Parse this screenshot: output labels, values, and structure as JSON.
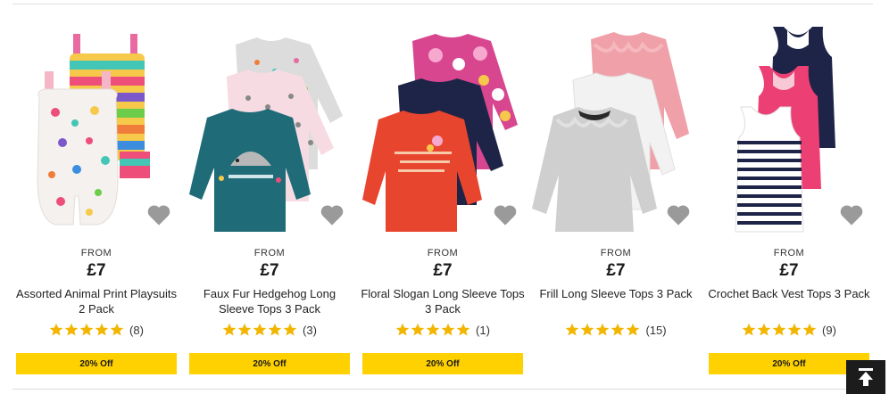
{
  "products": [
    {
      "from_label": "FROM",
      "price": "£7",
      "title": "Assorted Animal Print Playsuits 2 Pack",
      "review_count": "(8)",
      "promo": "20% Off",
      "image_icon": "playsuits-image"
    },
    {
      "from_label": "FROM",
      "price": "£7",
      "title": "Faux Fur Hedgehog Long Sleeve Tops 3 Pack",
      "review_count": "(3)",
      "promo": "20% Off",
      "image_icon": "hedgehog-tops-image"
    },
    {
      "from_label": "FROM",
      "price": "£7",
      "title": "Floral Slogan Long Sleeve Tops 3 Pack",
      "review_count": "(1)",
      "promo": "20% Off",
      "image_icon": "floral-tops-image"
    },
    {
      "from_label": "FROM",
      "price": "£7",
      "title": "Frill Long Sleeve Tops 3 Pack",
      "review_count": "(15)",
      "promo": "",
      "image_icon": "frill-tops-image"
    },
    {
      "from_label": "FROM",
      "price": "£7",
      "title": "Crochet Back Vest Tops 3 Pack",
      "review_count": "(9)",
      "promo": "20% Off",
      "image_icon": "vest-tops-image"
    }
  ],
  "rating_stars": 5,
  "colors": {
    "star": "#f2b600",
    "promo_bg": "#ffd100",
    "heart": "#9a9a9a",
    "back_to_top_bg": "#1c1c1c"
  },
  "back_to_top_icon": "arrow-up-to-line-icon"
}
